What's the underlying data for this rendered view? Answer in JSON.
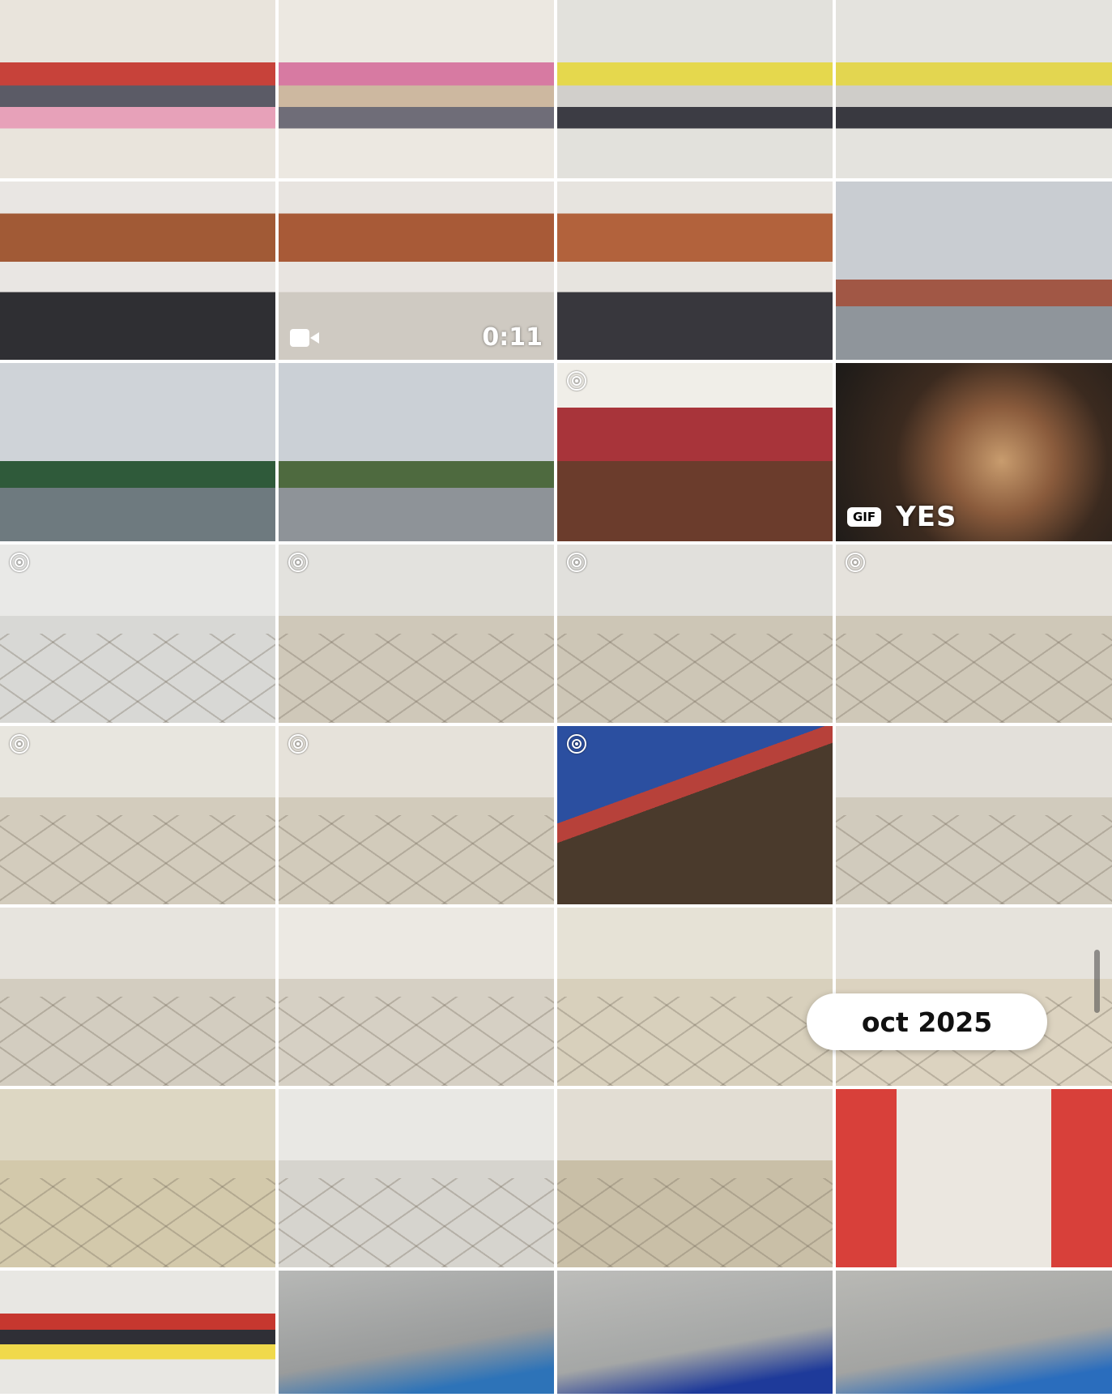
{
  "gallery": {
    "date_label": "oct 2025",
    "tiles": [
      {
        "kind": "photo",
        "icon": "classroom",
        "colors": [
          "#e9e4dc",
          "#c7423a",
          "#e7a1b9",
          "#5b5b66"
        ]
      },
      {
        "kind": "photo",
        "icon": "classroom",
        "colors": [
          "#ece8e1",
          "#d77aa2",
          "#6f6d78",
          "#cdb8a0"
        ]
      },
      {
        "kind": "photo",
        "icon": "classroom",
        "colors": [
          "#e2e1dc",
          "#e5d84d",
          "#3c3c44",
          "#d1cfcb"
        ]
      },
      {
        "kind": "photo",
        "icon": "classroom",
        "colors": [
          "#e4e3de",
          "#e3d650",
          "#393940",
          "#cfcdc9"
        ]
      },
      {
        "kind": "photo",
        "icon": "exercise",
        "colors": [
          "#e9e6e3",
          "#a15a36",
          "#d64b72",
          "#2f2f33"
        ]
      },
      {
        "kind": "video",
        "duration": "0:11",
        "icon": "exercise",
        "colors": [
          "#e8e4e0",
          "#a85a37",
          "#3f3f48",
          "#cfcac2"
        ]
      },
      {
        "kind": "photo",
        "icon": "exercise",
        "colors": [
          "#e7e4df",
          "#b2623c",
          "#cc3f62",
          "#38373d"
        ]
      },
      {
        "kind": "photo",
        "icon": "truck",
        "colors": [
          "#c9cdd2",
          "#8f959b",
          "#a15745",
          "#5b7a3f"
        ]
      },
      {
        "kind": "photo",
        "icon": "utility",
        "colors": [
          "#cfd3d8",
          "#6e7a7f",
          "#2f5a3a",
          "#e2e2e2"
        ]
      },
      {
        "kind": "photo",
        "icon": "utility",
        "colors": [
          "#cbd0d6",
          "#8e9398",
          "#4e6a3f",
          "#a3a3a3"
        ]
      },
      {
        "kind": "live",
        "icon": "snack",
        "colors": [
          "#6b3c2c",
          "#a8343a",
          "#f0eee8",
          "#d98c7a"
        ]
      },
      {
        "kind": "gif",
        "badge": "GIF",
        "caption": "YES",
        "icon": "pirate",
        "colors": [
          "#3b2a1f",
          "#8a5b3c",
          "#1c1a18",
          "#c89c6e"
        ]
      },
      {
        "kind": "live",
        "icon": "sink",
        "colors": [
          "#e9e9e7",
          "#d8d8d5",
          "#7d7d7d",
          "#f4f4f2"
        ]
      },
      {
        "kind": "live",
        "icon": "toilet",
        "colors": [
          "#e3e2de",
          "#cfc8b9",
          "#1d1d1d",
          "#3f6e4b"
        ]
      },
      {
        "kind": "live",
        "icon": "toilet",
        "colors": [
          "#e1e0dc",
          "#cdc6b6",
          "#1e5a3c",
          "#1b1b1b"
        ]
      },
      {
        "kind": "live",
        "icon": "door",
        "colors": [
          "#e5e2dc",
          "#cfc8b8",
          "#c0402b",
          "#9e9a94"
        ]
      },
      {
        "kind": "live",
        "icon": "hall",
        "colors": [
          "#e8e6df",
          "#d3ccbd",
          "#e36cb1",
          "#9f3b28"
        ]
      },
      {
        "kind": "live",
        "icon": "hall",
        "colors": [
          "#e6e2da",
          "#d2cbbb",
          "#a9482d",
          "#b9cad8"
        ]
      },
      {
        "kind": "live",
        "icon": "wet-floor",
        "colors": [
          "#4a3a2c",
          "#b7413a",
          "#2b4fa0",
          "#e8e6e2"
        ]
      },
      {
        "kind": "photo",
        "icon": "gym",
        "colors": [
          "#e3e0da",
          "#d1cbbd",
          "#2d2d30",
          "#a9a5a0"
        ]
      },
      {
        "kind": "photo",
        "icon": "hall",
        "colors": [
          "#e7e4de",
          "#d3cdc0",
          "#8a3c2c",
          "#f3f2ef"
        ]
      },
      {
        "kind": "photo",
        "icon": "floor",
        "colors": [
          "#ece9e3",
          "#d6d0c4",
          "#c9c3b6",
          "#f4f2ee"
        ]
      },
      {
        "kind": "photo",
        "icon": "floor",
        "colors": [
          "#e6e2d6",
          "#d8d0bc",
          "#cdc5ae",
          "#2f6b3e"
        ]
      },
      {
        "kind": "photo",
        "icon": "toilet",
        "colors": [
          "#e6e3dc",
          "#dcd3c0",
          "#fbfbfa",
          "#c9c1ad"
        ]
      },
      {
        "kind": "photo",
        "icon": "toilet",
        "colors": [
          "#ddd7c3",
          "#d3c9ab",
          "#1d5e33",
          "#f1f1ee"
        ]
      },
      {
        "kind": "photo",
        "icon": "sink",
        "colors": [
          "#e9e8e4",
          "#d6d4ce",
          "#5e5a52",
          "#f5f5f3"
        ]
      },
      {
        "kind": "photo",
        "icon": "urinal",
        "colors": [
          "#e2ddd3",
          "#c9bfa7",
          "#7b6240",
          "#f2f2f0"
        ]
      },
      {
        "kind": "photo",
        "icon": "corridor",
        "colors": [
          "#d8403a",
          "#ebe7e0",
          "#2b9ec8",
          "#5e4d47"
        ]
      },
      {
        "kind": "photo",
        "icon": "classroom",
        "colors": [
          "#e8e7e3",
          "#c6372f",
          "#f0d94b",
          "#2f2f36"
        ]
      },
      {
        "kind": "photo",
        "icon": "concrete",
        "colors": [
          "#9a9c9c",
          "#b7b8b6",
          "#2d73b8",
          "#3fae58"
        ]
      },
      {
        "kind": "photo",
        "icon": "concrete",
        "colors": [
          "#a5a7a6",
          "#bdbdba",
          "#1e3a9a",
          "#2b8a8e"
        ]
      },
      {
        "kind": "photo",
        "icon": "concrete",
        "colors": [
          "#a3a4a2",
          "#b9b9b5",
          "#2a6dbd",
          "#6f7070"
        ]
      }
    ]
  }
}
